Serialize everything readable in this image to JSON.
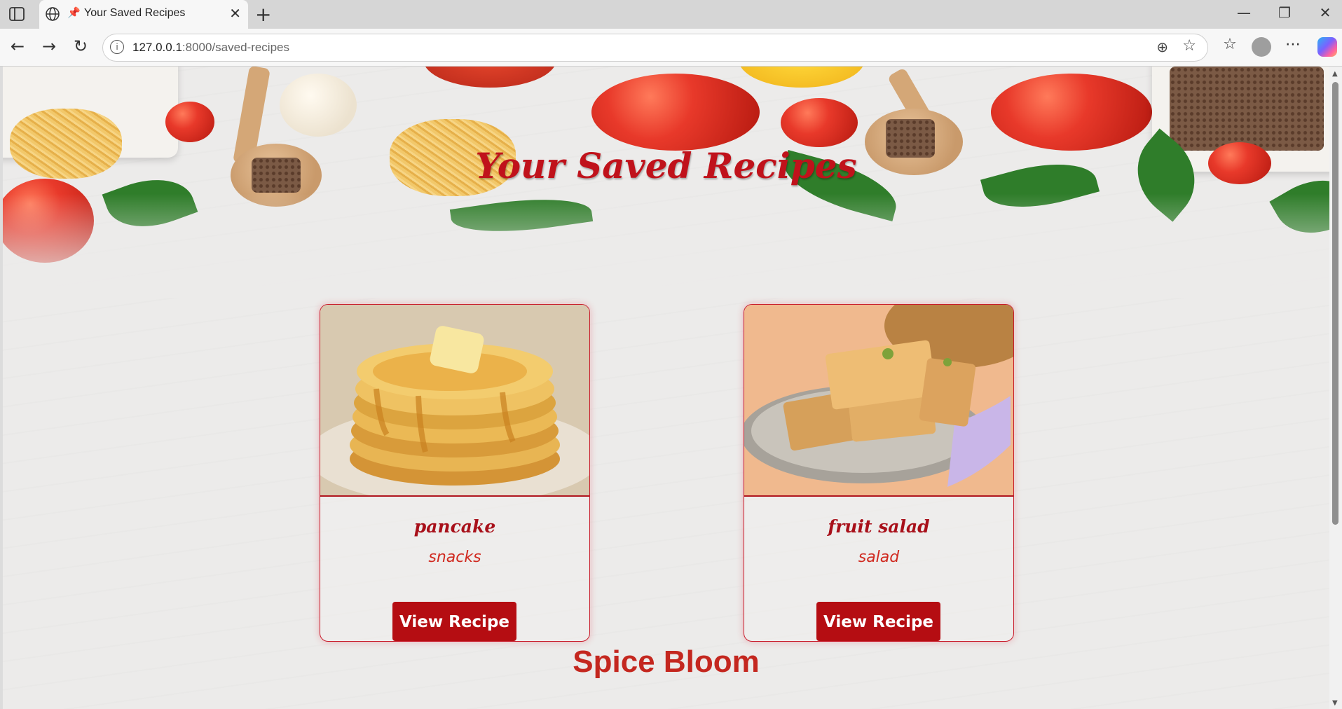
{
  "browser": {
    "tab_title": "Your Saved Recipes",
    "url_host": "127.0.0.1",
    "url_rest": ":8000/saved-recipes"
  },
  "page": {
    "heading": "Your Saved Recipes",
    "footer_brand": "Spice Bloom"
  },
  "recipes": [
    {
      "name": "pancake",
      "category": "snacks",
      "button": "View Recipe"
    },
    {
      "name": "fruit salad",
      "category": "salad",
      "button": "View Recipe"
    }
  ],
  "colors": {
    "accent": "#c0121b",
    "button": "#b50d12"
  }
}
